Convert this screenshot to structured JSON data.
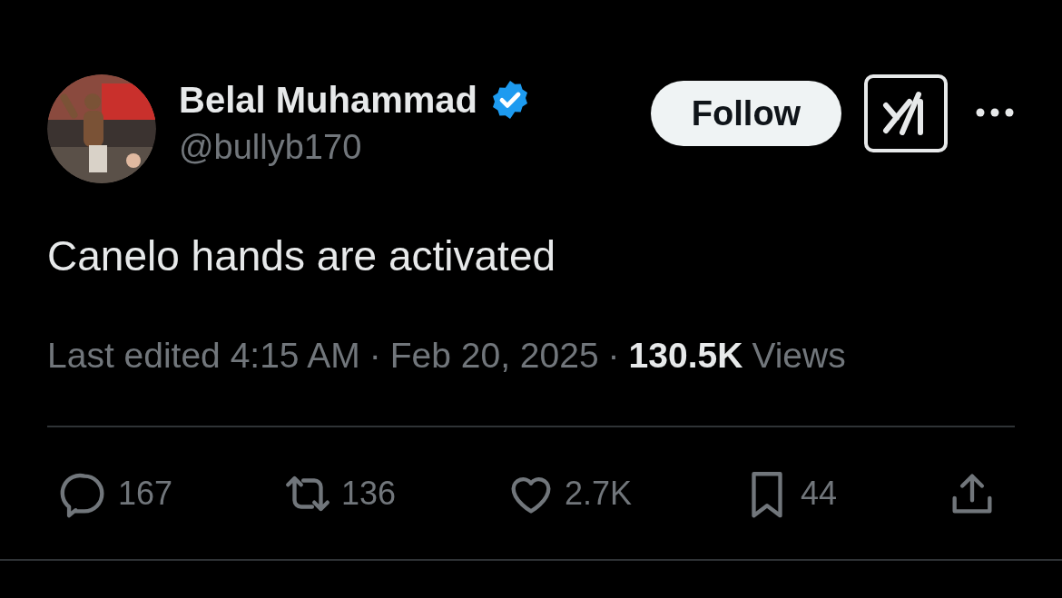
{
  "author": {
    "name": "Belal Muhammad",
    "verified": true,
    "handle": "@bullyb170"
  },
  "follow_button": {
    "label": "Follow"
  },
  "text": "Canelo hands are activated",
  "meta": {
    "edited": "Last edited 4:15 AM",
    "separator_1": "·",
    "date": "Feb 20, 2025",
    "separator_2": "·",
    "views_count": "130.5K",
    "views_label": "Views"
  },
  "actions": [
    {
      "kind": "reply",
      "count": "167"
    },
    {
      "kind": "repost",
      "count": "136"
    },
    {
      "kind": "like",
      "count": "2.7K"
    },
    {
      "kind": "bookmark",
      "count": "44"
    },
    {
      "kind": "share"
    }
  ]
}
